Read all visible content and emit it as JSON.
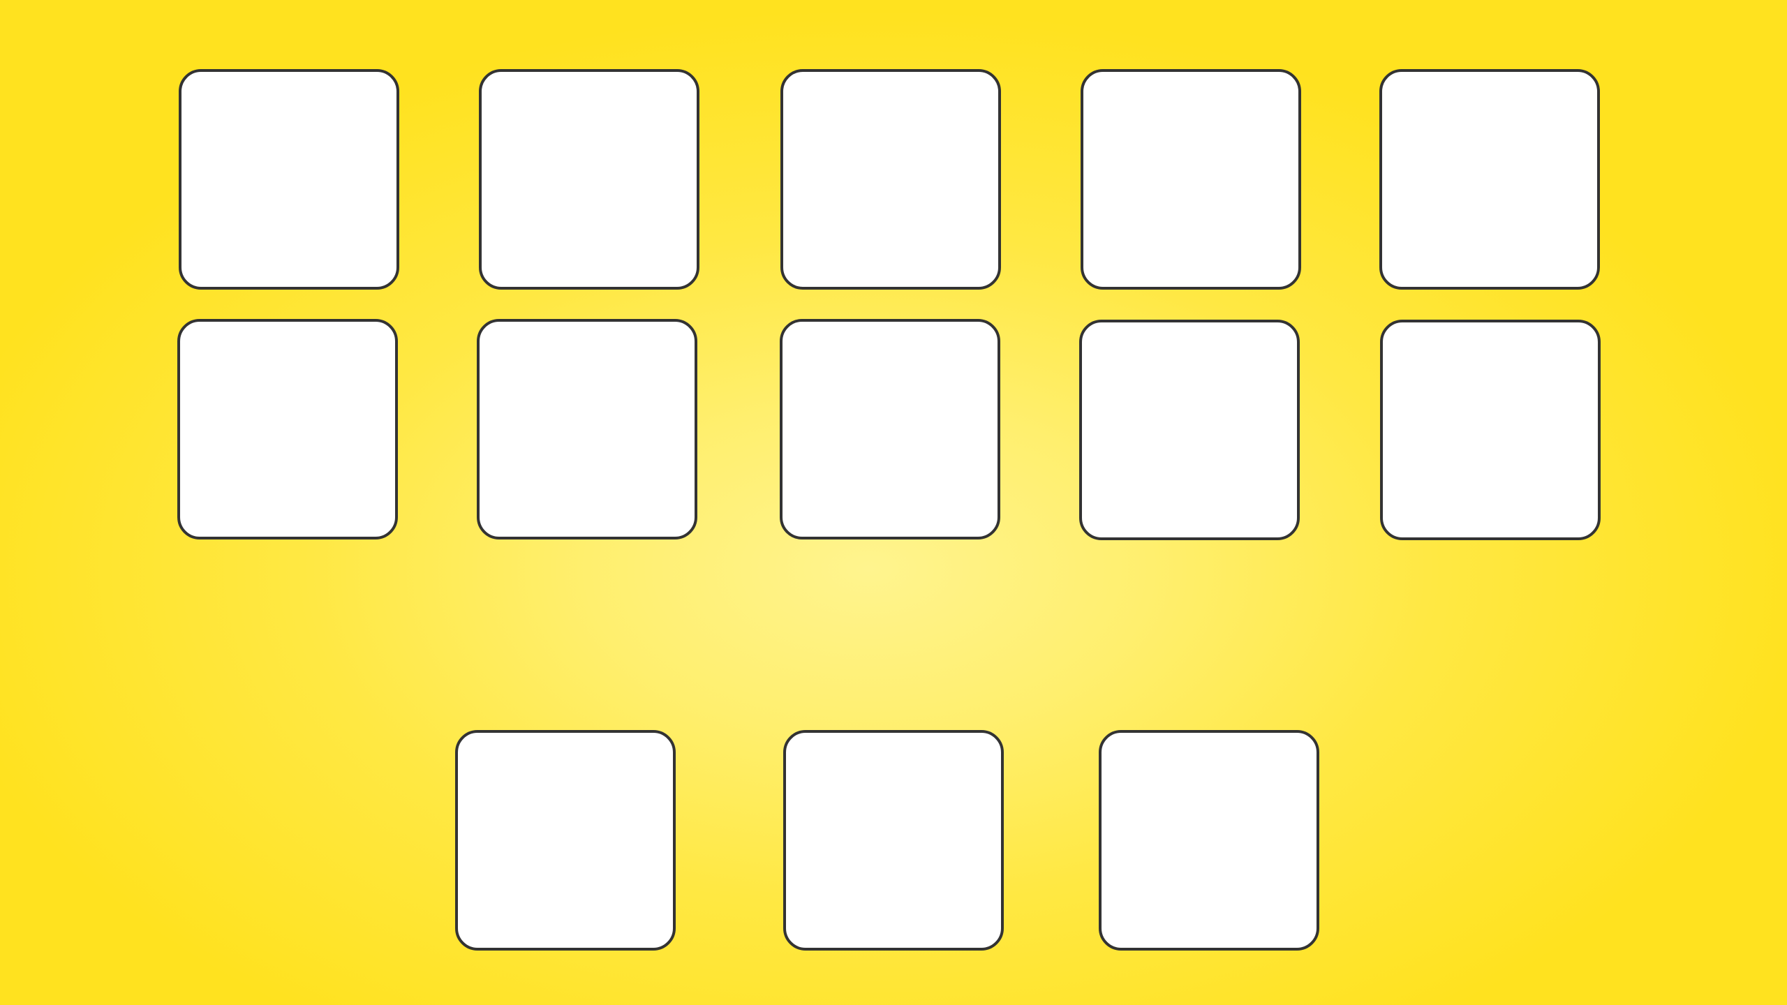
{
  "background": {
    "center_color": "#fff48e",
    "edge_color": "#ffe21f"
  },
  "card_style": {
    "face_color": "#ffffff",
    "border_color": "#333333"
  },
  "board": {
    "cards": [
      {
        "face": ""
      },
      {
        "face": ""
      },
      {
        "face": ""
      },
      {
        "face": ""
      },
      {
        "face": ""
      },
      {
        "face": ""
      },
      {
        "face": ""
      },
      {
        "face": ""
      },
      {
        "face": ""
      },
      {
        "face": ""
      }
    ]
  },
  "tray": {
    "cards": [
      {
        "face": ""
      },
      {
        "face": ""
      },
      {
        "face": ""
      }
    ]
  }
}
